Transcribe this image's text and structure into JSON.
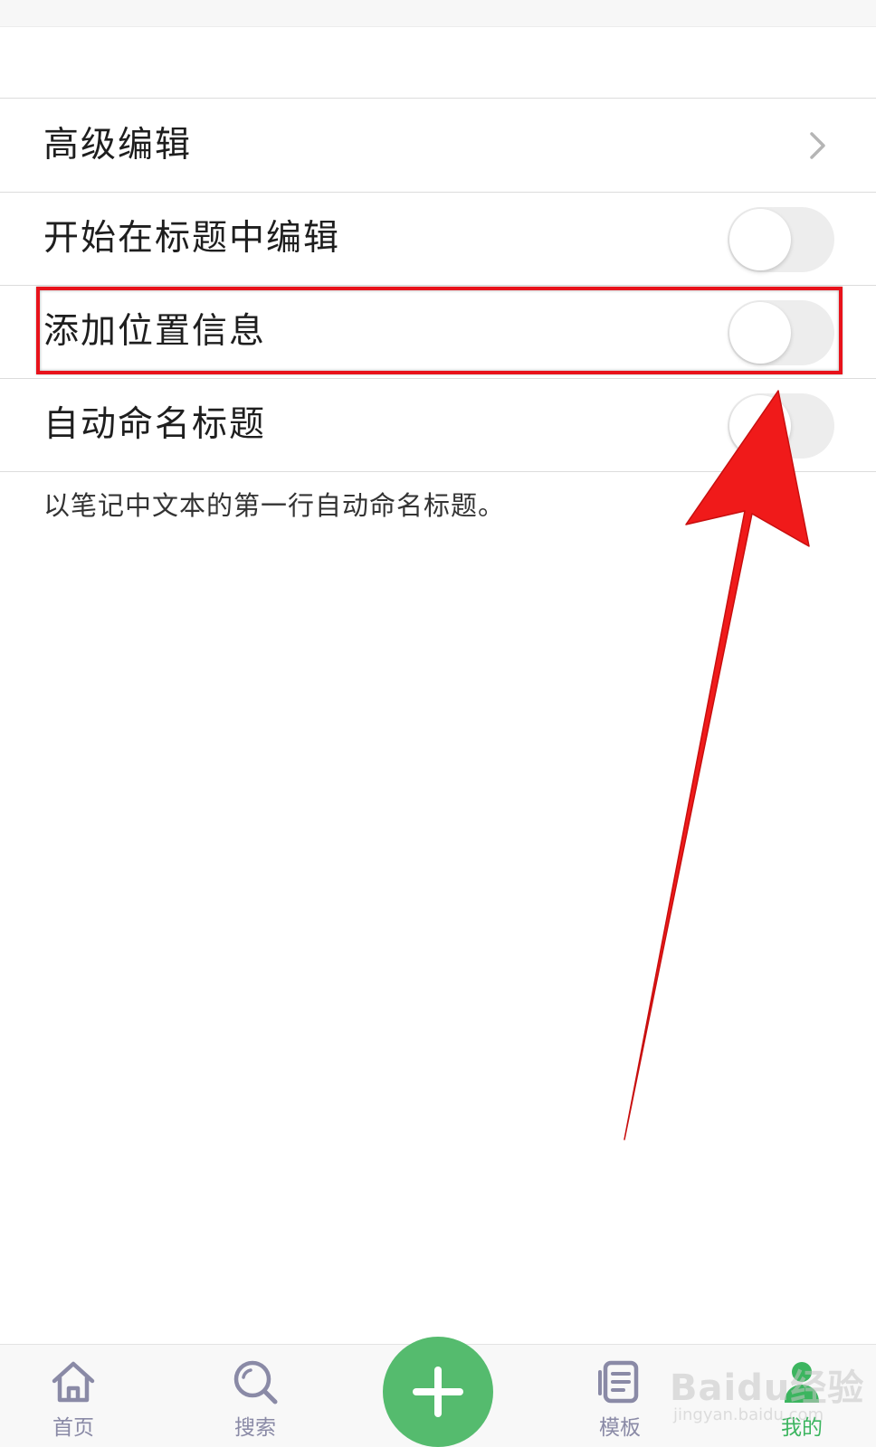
{
  "settings": {
    "items": [
      {
        "label": "高级编辑",
        "control": "chevron"
      },
      {
        "label": "开始在标题中编辑",
        "control": "toggle",
        "on": false
      },
      {
        "label": "添加位置信息",
        "control": "toggle",
        "on": false
      },
      {
        "label": "自动命名标题",
        "control": "toggle",
        "on": false
      }
    ],
    "description": "以笔记中文本的第一行自动命名标题。"
  },
  "annotation": {
    "highlight_color": "#e8121b",
    "arrow_color": "#f01a1a"
  },
  "tabbar": {
    "tabs": [
      {
        "label": "首页",
        "icon": "home-icon"
      },
      {
        "label": "搜索",
        "icon": "search-icon"
      },
      {
        "label": "模板",
        "icon": "template-icon"
      },
      {
        "label": "我的",
        "icon": "profile-icon"
      }
    ],
    "add_icon": "plus-icon",
    "active_color": "#3cb55f",
    "inactive_color": "#8a8aa6",
    "add_button_color": "#55bb6e"
  },
  "watermark": {
    "main": "Baidu经验",
    "sub": "jingyan.baidu.com"
  }
}
